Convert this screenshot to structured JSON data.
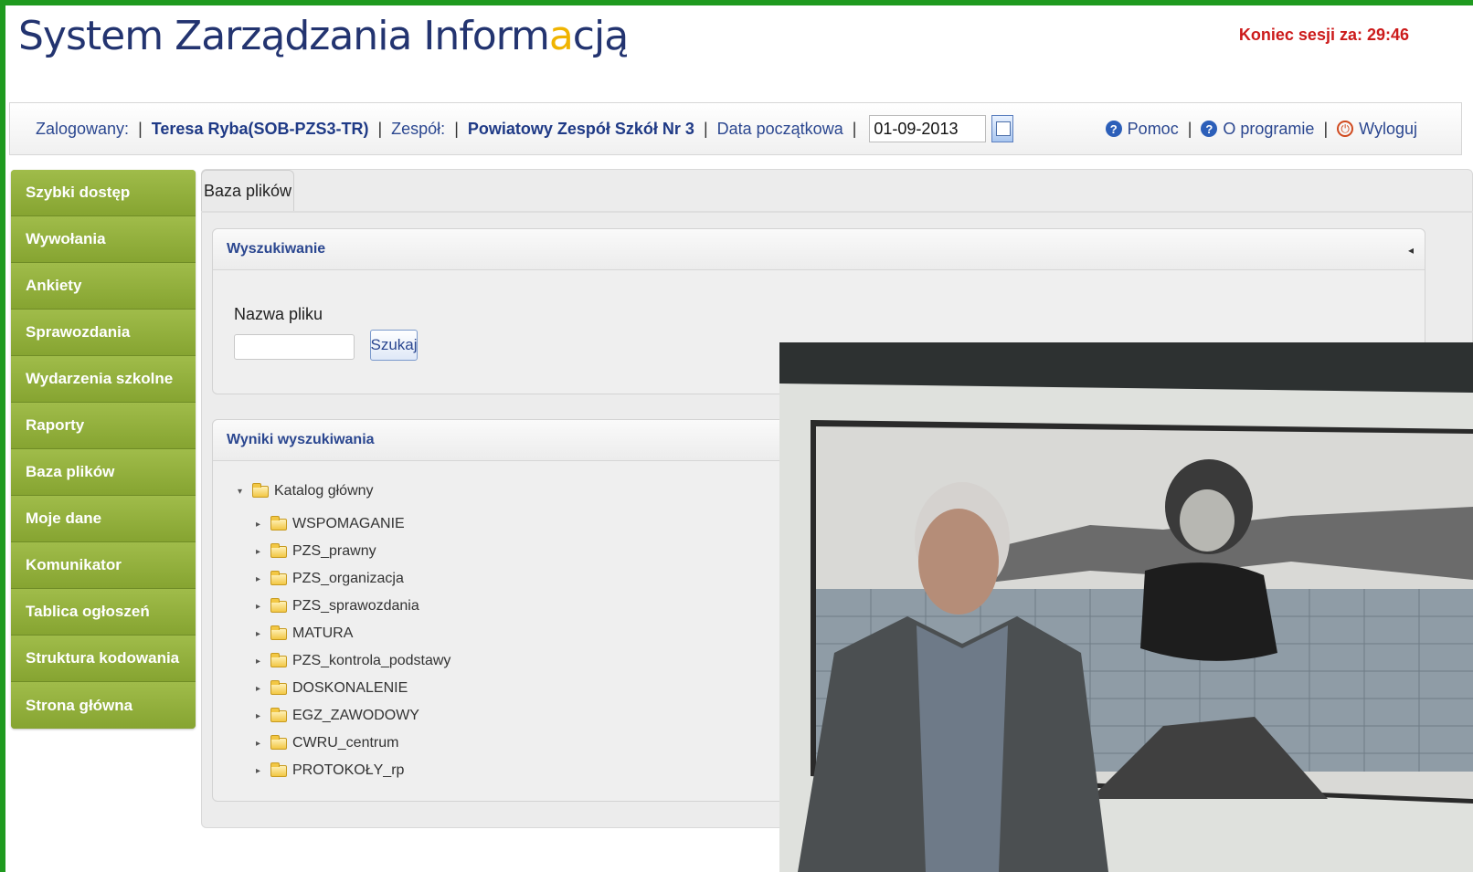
{
  "header": {
    "title_main": "System Zarządzania Inform",
    "title_accent": "a",
    "title_tail": "cją",
    "session_label": "Koniec sesji za: 29:46"
  },
  "userbar": {
    "logged_label": "Zalogowany:",
    "user": "Teresa Ryba(SOB-PZS3-TR)",
    "team_label": "Zespół:",
    "team": "Powiatowy Zespół Szkół Nr 3",
    "date_label": "Data początkowa",
    "date_value": "01-09-2013",
    "help": "Pomoc",
    "about": "O programie",
    "logout": "Wyloguj"
  },
  "sidebar": {
    "items": [
      "Szybki dostęp",
      "Wywołania",
      "Ankiety",
      "Sprawozdania",
      "Wydarzenia szkolne",
      "Raporty",
      "Baza plików",
      "Moje dane",
      "Komunikator",
      "Tablica ogłoszeń",
      "Struktura kodowania",
      "Strona główna"
    ]
  },
  "main": {
    "tab": "Baza plików",
    "search_panel": {
      "title": "Wyszukiwanie",
      "field_label": "Nazwa pliku",
      "field_value": "",
      "button": "Szukaj"
    },
    "results_panel": {
      "title": "Wyniki wyszukiwania",
      "root": "Katalog główny",
      "folders": [
        "WSPOMAGANIE",
        "PZS_prawny",
        "PZS_organizacja",
        "PZS_sprawozdania",
        "MATURA",
        "PZS_kontrola_podstawy",
        "DOSKONALENIE",
        "EGZ_ZAWODOWY",
        "CWRU_centrum",
        "PROTOKOŁY_rp"
      ]
    }
  },
  "colors": {
    "frame": "#1f9a1f",
    "sidebar": "#8fad3a",
    "title": "#233470",
    "accent": "#f0b400",
    "session": "#cc1b1b",
    "link": "#2b4790"
  },
  "icons": [
    "help-icon",
    "info-icon",
    "power-icon",
    "calendar-icon",
    "folder-icon",
    "collapse-icon"
  ]
}
